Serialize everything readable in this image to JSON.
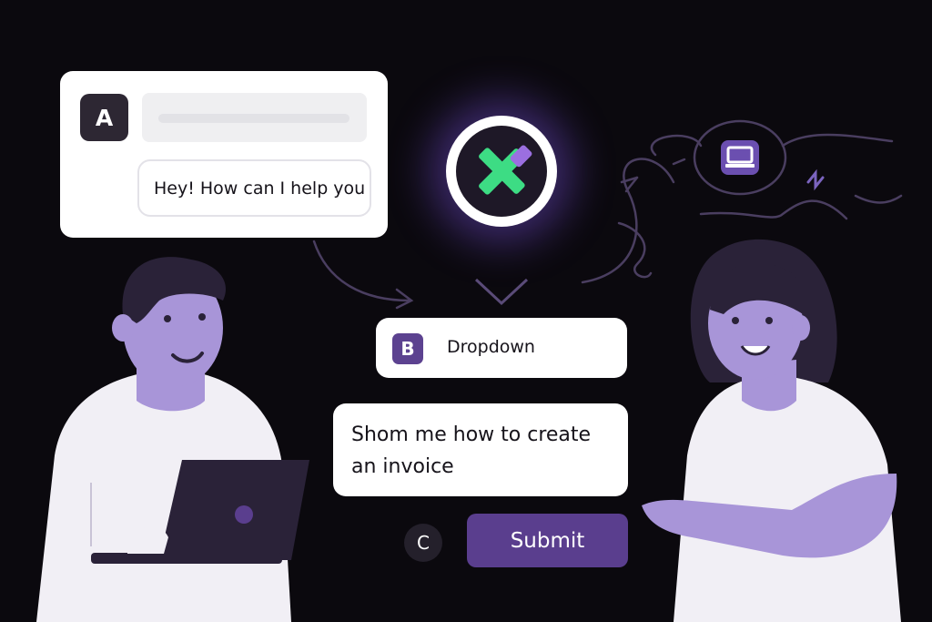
{
  "chat_card": {
    "badge": "A",
    "greeting": "Hey! How can I help you"
  },
  "dropdown": {
    "badge": "B",
    "label": "Dropdown"
  },
  "prompt": {
    "text": "Shom me how to create an invoice"
  },
  "actions": {
    "badge": "C",
    "submit_label": "Submit"
  },
  "icons": {
    "logo": "x-logo-icon",
    "laptop": "laptop-icon",
    "chevron": "chevron-down-icon"
  },
  "colors": {
    "background": "#0b090e",
    "accent_purple": "#5a3e8e",
    "light_purple": "#a895d8",
    "logo_green": "#3ddc84"
  }
}
